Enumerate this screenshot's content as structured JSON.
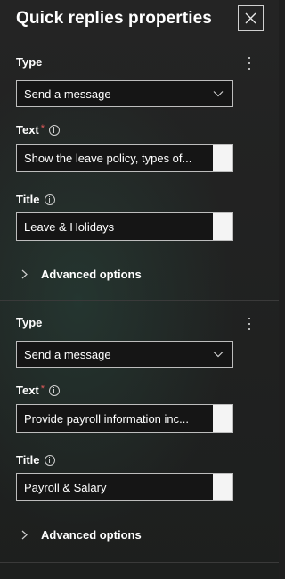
{
  "header": {
    "title": "Quick replies properties",
    "close_icon": "close-icon"
  },
  "replies": [
    {
      "type_label": "Type",
      "type_value": "Send a message",
      "text_label": "Text",
      "text_required": "*",
      "text_value": "Show the leave policy, types of...",
      "title_label": "Title",
      "title_value": "Leave & Holidays",
      "advanced_label": "Advanced options"
    },
    {
      "type_label": "Type",
      "type_value": "Send a message",
      "text_label": "Text",
      "text_required": "*",
      "text_value": "Provide payroll information inc...",
      "title_label": "Title",
      "title_value": "Payroll & Salary",
      "advanced_label": "Advanced options"
    }
  ],
  "colors": {
    "background": "#1f1f1f",
    "text": "#ffffff",
    "required": "#e05a5a",
    "border": "#bdbdbd"
  }
}
